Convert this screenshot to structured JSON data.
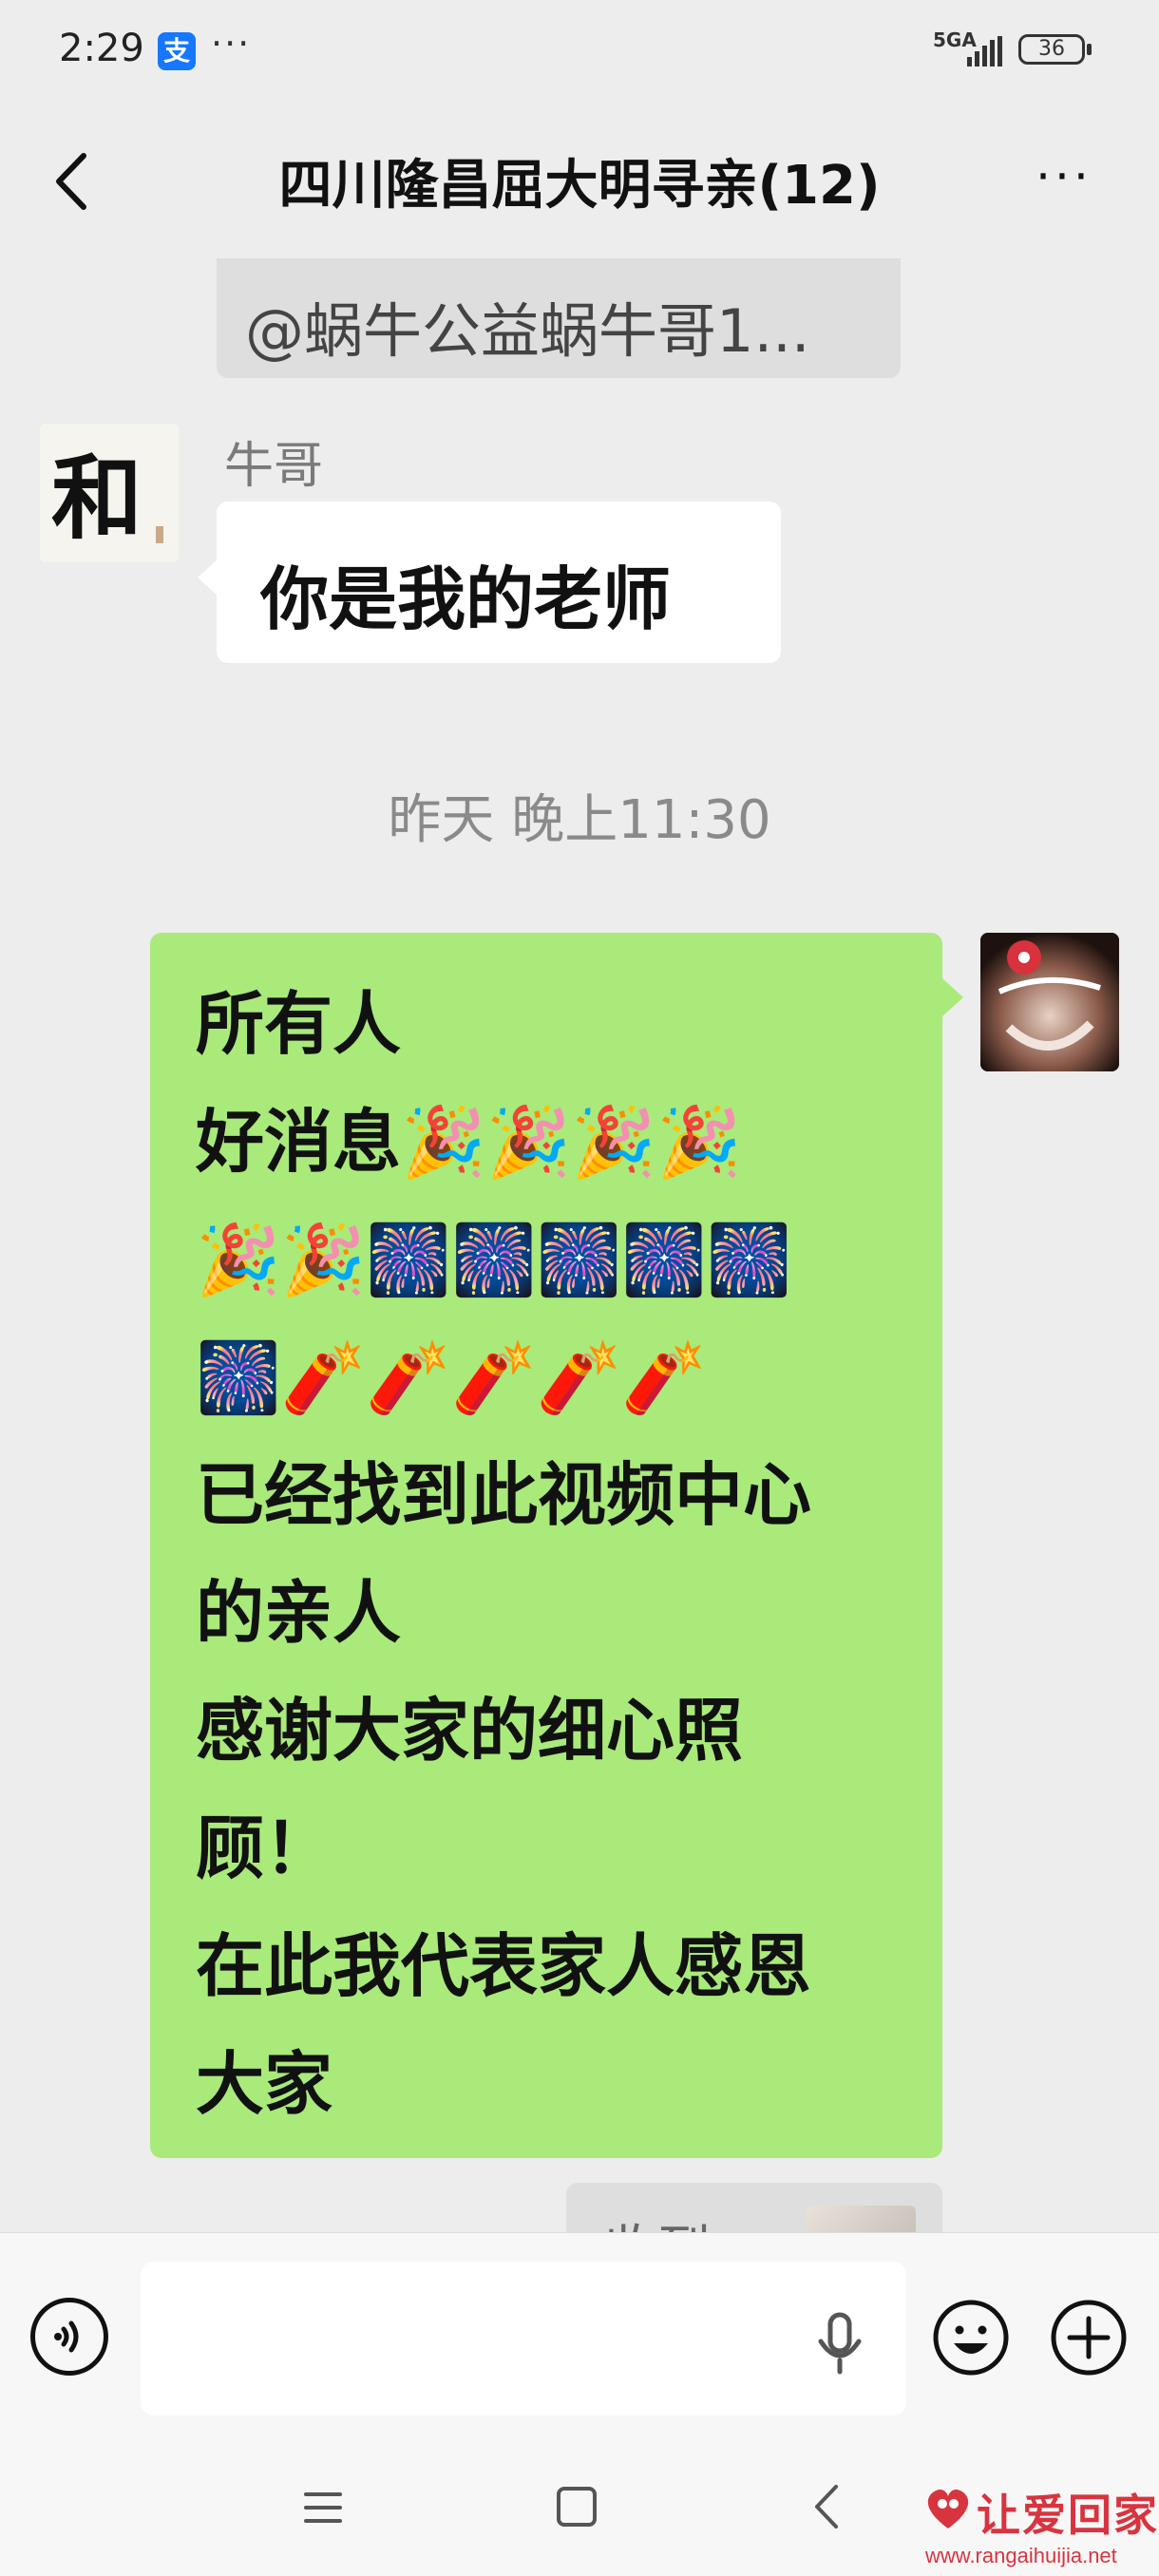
{
  "status_bar": {
    "time": "2:29",
    "alipay_badge": "支",
    "more": "···",
    "network": "5GA",
    "battery": "36"
  },
  "header": {
    "back_icon": "chevron-left-icon",
    "title": "四川隆昌屈大明寻亲(12)",
    "menu": "···"
  },
  "messages": {
    "quote": "@蜗牛公益蜗牛哥1...",
    "left_message": {
      "sender": "牛哥",
      "avatar_text": "和",
      "text": "你是我的老师"
    },
    "timestamp": "昨天 晚上11:30",
    "right_message": {
      "lines": [
        "所有人",
        "好消息🎉🎉🎉🎉",
        "🎉🎉🎆🎆🎆🎆🎆",
        "🎆🧨🧨🧨🧨🧨",
        "已经找到此视频中心",
        "的亲人",
        "感谢大家的细心照",
        "顾！",
        "在此我代表家人感恩",
        "大家"
      ]
    },
    "next_bubble_text": "收到"
  },
  "input_bar": {
    "placeholder": "",
    "icons": [
      "voice-icon",
      "microphone-icon",
      "emoji-icon",
      "plus-icon"
    ]
  },
  "nav": {
    "icons": [
      "menu-icon",
      "home-icon",
      "back-icon"
    ]
  },
  "watermark": {
    "text": "让爱回家",
    "url": "www.rangaihuijia.net"
  },
  "colors": {
    "background": "#ededed",
    "own_bubble": "#a9ea7a",
    "other_bubble": "#ffffff",
    "watermark": "#d8343f"
  }
}
